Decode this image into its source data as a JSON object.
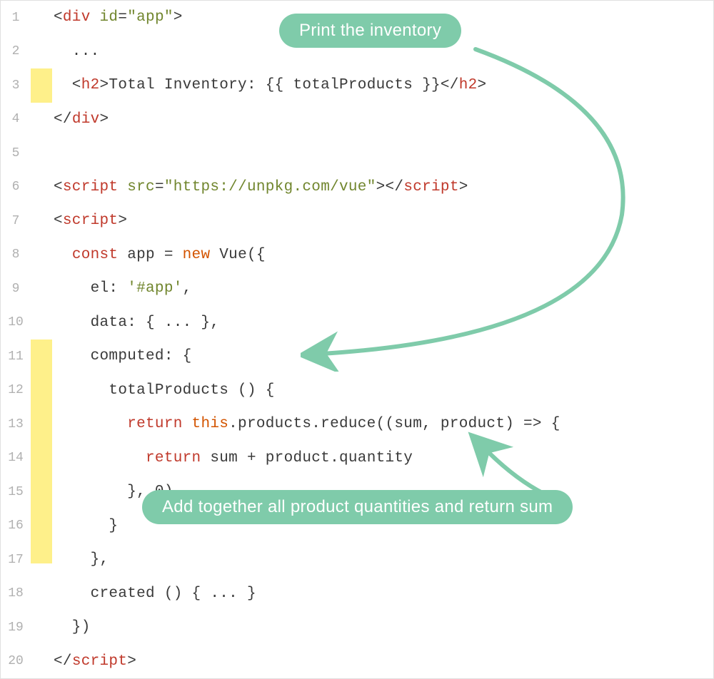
{
  "annotations": {
    "top": "Print the inventory",
    "bottom": "Add together all product quantities and return sum"
  },
  "code_lines": [
    {
      "num": "1",
      "highlighted": false,
      "segments": [
        {
          "text": "<",
          "cls": "punct"
        },
        {
          "text": "div",
          "cls": "tag"
        },
        {
          "text": " ",
          "cls": "text"
        },
        {
          "text": "id",
          "cls": "attr"
        },
        {
          "text": "=",
          "cls": "punct"
        },
        {
          "text": "\"app\"",
          "cls": "string"
        },
        {
          "text": ">",
          "cls": "punct"
        }
      ]
    },
    {
      "num": "2",
      "highlighted": false,
      "segments": [
        {
          "text": "  ...",
          "cls": "text"
        }
      ]
    },
    {
      "num": "3",
      "highlighted": true,
      "segments": [
        {
          "text": "  <",
          "cls": "punct"
        },
        {
          "text": "h2",
          "cls": "tag"
        },
        {
          "text": ">Total Inventory: {{ totalProducts }}</",
          "cls": "text"
        },
        {
          "text": "h2",
          "cls": "tag"
        },
        {
          "text": ">",
          "cls": "punct"
        }
      ]
    },
    {
      "num": "4",
      "highlighted": false,
      "segments": [
        {
          "text": "</",
          "cls": "punct"
        },
        {
          "text": "div",
          "cls": "tag"
        },
        {
          "text": ">",
          "cls": "punct"
        }
      ]
    },
    {
      "num": "5",
      "highlighted": false,
      "segments": []
    },
    {
      "num": "6",
      "highlighted": false,
      "segments": [
        {
          "text": "<",
          "cls": "punct"
        },
        {
          "text": "script",
          "cls": "tag"
        },
        {
          "text": " ",
          "cls": "text"
        },
        {
          "text": "src",
          "cls": "attr"
        },
        {
          "text": "=",
          "cls": "punct"
        },
        {
          "text": "\"https://unpkg.com/vue\"",
          "cls": "string"
        },
        {
          "text": "></",
          "cls": "punct"
        },
        {
          "text": "script",
          "cls": "tag"
        },
        {
          "text": ">",
          "cls": "punct"
        }
      ]
    },
    {
      "num": "7",
      "highlighted": false,
      "segments": [
        {
          "text": "<",
          "cls": "punct"
        },
        {
          "text": "script",
          "cls": "tag"
        },
        {
          "text": ">",
          "cls": "punct"
        }
      ]
    },
    {
      "num": "8",
      "highlighted": false,
      "segments": [
        {
          "text": "  ",
          "cls": "text"
        },
        {
          "text": "const",
          "cls": "keyword"
        },
        {
          "text": " app = ",
          "cls": "text"
        },
        {
          "text": "new",
          "cls": "keyword2"
        },
        {
          "text": " Vue({",
          "cls": "text"
        }
      ]
    },
    {
      "num": "9",
      "highlighted": false,
      "segments": [
        {
          "text": "    el: ",
          "cls": "text"
        },
        {
          "text": "'#app'",
          "cls": "string"
        },
        {
          "text": ",",
          "cls": "text"
        }
      ]
    },
    {
      "num": "10",
      "highlighted": false,
      "segments": [
        {
          "text": "    data: { ... },",
          "cls": "text"
        }
      ]
    },
    {
      "num": "11",
      "highlighted": true,
      "segments": [
        {
          "text": "    computed: {",
          "cls": "text"
        }
      ]
    },
    {
      "num": "12",
      "highlighted": true,
      "segments": [
        {
          "text": "      totalProducts () {",
          "cls": "text"
        }
      ]
    },
    {
      "num": "13",
      "highlighted": true,
      "segments": [
        {
          "text": "        ",
          "cls": "text"
        },
        {
          "text": "return",
          "cls": "keyword"
        },
        {
          "text": " ",
          "cls": "text"
        },
        {
          "text": "this",
          "cls": "keyword2"
        },
        {
          "text": ".products.reduce((sum, product) => {",
          "cls": "text"
        }
      ]
    },
    {
      "num": "14",
      "highlighted": true,
      "segments": [
        {
          "text": "          ",
          "cls": "text"
        },
        {
          "text": "return",
          "cls": "keyword"
        },
        {
          "text": " sum + product.quantity",
          "cls": "text"
        }
      ]
    },
    {
      "num": "15",
      "highlighted": true,
      "segments": [
        {
          "text": "        }, 0)",
          "cls": "text"
        }
      ]
    },
    {
      "num": "16",
      "highlighted": true,
      "segments": [
        {
          "text": "      }",
          "cls": "text"
        }
      ]
    },
    {
      "num": "17",
      "highlighted": true,
      "highlight_short": true,
      "segments": [
        {
          "text": "    },",
          "cls": "text"
        }
      ]
    },
    {
      "num": "18",
      "highlighted": false,
      "segments": [
        {
          "text": "    created () { ... }",
          "cls": "text"
        }
      ]
    },
    {
      "num": "19",
      "highlighted": false,
      "segments": [
        {
          "text": "  })",
          "cls": "text"
        }
      ]
    },
    {
      "num": "20",
      "highlighted": false,
      "segments": [
        {
          "text": "</",
          "cls": "punct"
        },
        {
          "text": "script",
          "cls": "tag"
        },
        {
          "text": ">",
          "cls": "punct"
        }
      ]
    }
  ]
}
